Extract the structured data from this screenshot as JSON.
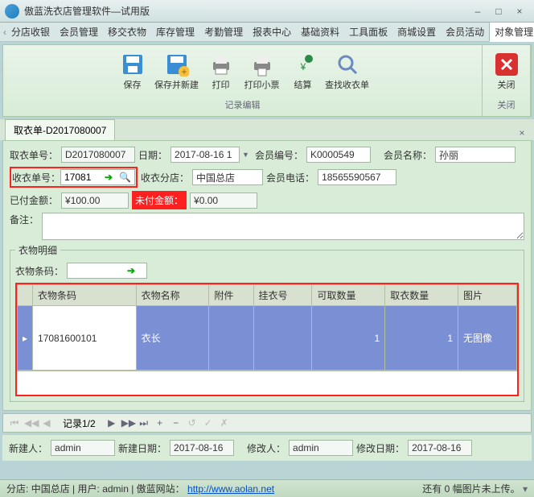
{
  "window": {
    "title": "傲蓝洗衣店管理软件—试用版"
  },
  "menu": {
    "items": [
      "分店收银",
      "会员管理",
      "移交衣物",
      "库存管理",
      "考勤管理",
      "报表中心",
      "基础资料",
      "工具面板",
      "商城设置",
      "会员活动",
      "对象管理"
    ]
  },
  "ribbon": {
    "save": "保存",
    "saveNew": "保存并新建",
    "print": "打印",
    "printTicket": "打印小票",
    "settle": "结算",
    "lookup": "查找收衣单",
    "groupEdit": "记录编辑",
    "close": "关闭",
    "groupClose": "关闭"
  },
  "tab": {
    "label": "取衣单-D2017080007"
  },
  "form": {
    "pickNoLabel": "取衣单号：",
    "pickNo": "D2017080007",
    "dateLabel": "日期：",
    "date": "2017-08-16 1",
    "memberNoLabel": "会员编号：",
    "memberNo": "K0000549",
    "memberNameLabel": "会员名称：",
    "memberName": "孙丽",
    "recvNoLabel": "收衣单号：",
    "recvNo": "17081",
    "branchLabel": "收衣分店：",
    "branch": "中国总店",
    "phoneLabel": "会员电话：",
    "phone": "18565590567",
    "paidLabel": "已付金额：",
    "paid": "¥100.00",
    "unpaidLabel": "未付金额：",
    "unpaid": "¥0.00",
    "remarkLabel": "备注："
  },
  "detail": {
    "legend": "衣物明细",
    "barcodeLabel": "衣物条码：",
    "cols": {
      "c0": "衣物条码",
      "c1": "衣物名称",
      "c2": "附件",
      "c3": "挂衣号",
      "c4": "可取数量",
      "c5": "取衣数量",
      "c6": "图片"
    },
    "row": {
      "barcode": "17081600101",
      "name": "衣长",
      "attach": "",
      "hang": "",
      "canQty": "1",
      "takeQty": "1",
      "pic": "无图像"
    }
  },
  "nav": {
    "counter": "记录1/2"
  },
  "audit": {
    "createdByLabel": "新建人：",
    "createdBy": "admin",
    "createdDateLabel": "新建日期：",
    "createdDate": "2017-08-16",
    "modifiedByLabel": "修改人：",
    "modifiedBy": "admin",
    "modifiedDateLabel": "修改日期：",
    "modifiedDate": "2017-08-16"
  },
  "status": {
    "branchLabel": "分店:",
    "branch": "中国总店",
    "userLabel": "用户:",
    "user": "admin",
    "siteLabel": "傲蓝网站：",
    "site": "http://www.aolan.net",
    "right": "还有 0 幅图片未上传。"
  }
}
